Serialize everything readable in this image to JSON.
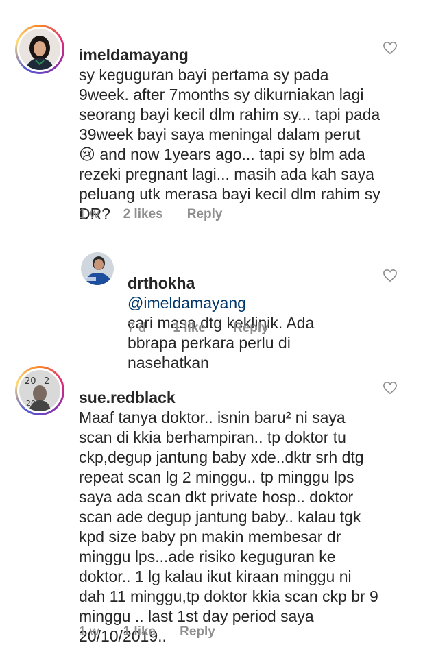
{
  "comments": [
    {
      "username": "imeldamayang",
      "text": "sy keguguran bayi pertama sy pada 9week. after 7months sy dikurniakan lagi seorang bayi kecil dlm rahim sy... tapi pada 39week bayi saya meningal dalam perut 😢 and now 1years ago... tapi sy blm ada rezeki pregnant lagi... masih ada kah saya peluang utk merasa bayi kecil dlm rahim sy DR?",
      "time": "1 w",
      "likes": "2 likes",
      "reply": "Reply"
    },
    {
      "username": "drthokha",
      "mention": "@imeldamayang",
      "text": "cari masa dtg keklinik. Ada bbrapa perkara perlu di nasehatkan",
      "time": "7 d",
      "likes": "1 like",
      "reply": "Reply"
    },
    {
      "username": "sue.redblack",
      "text": "Maaf tanya doktor.. isnin baru² ni saya scan di kkia berhampiran.. tp doktor tu ckp,degup jantung baby xde..dktr srh dtg repeat scan lg 2 minggu.. tp minggu lps saya ada scan dkt private hosp.. doktor scan ade degup jantung baby.. kalau tgk kpd size baby pn makin membesar dr minggu lps...ade risiko keguguran ke doktor.. 1 lg kalau ikut kiraan minggu ni dah 11 minggu,tp doktor kkia scan ckp br 9 minggu .. last 1st day period saya 20/10/2019..",
      "time": "1 w",
      "likes": "1 like",
      "reply": "Reply"
    }
  ]
}
